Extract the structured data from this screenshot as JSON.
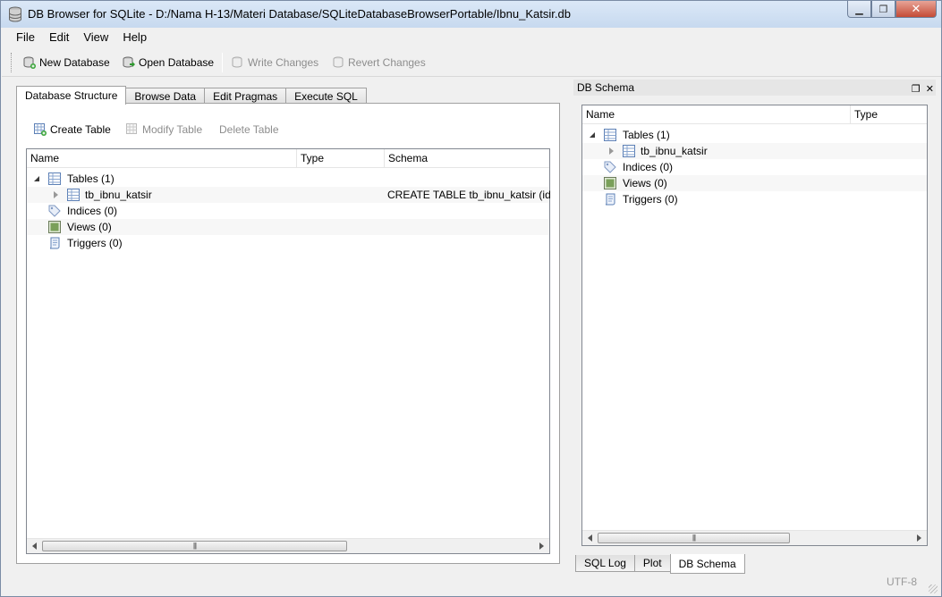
{
  "window": {
    "title": "DB Browser for SQLite - D:/Nama H-13/Materi Database/SQLiteDatabaseBrowserPortable/Ibnu_Katsir.db",
    "app_icon": "database-icon"
  },
  "menu": [
    "File",
    "Edit",
    "View",
    "Help"
  ],
  "toolbar": {
    "new_database": "New Database",
    "open_database": "Open Database",
    "write_changes": "Write Changes",
    "revert_changes": "Revert Changes"
  },
  "tabs": [
    "Database Structure",
    "Browse Data",
    "Edit Pragmas",
    "Execute SQL"
  ],
  "structure": {
    "create_table": "Create Table",
    "modify_table": "Modify Table",
    "delete_table": "Delete Table",
    "columns": [
      "Name",
      "Type",
      "Schema"
    ],
    "rows": [
      {
        "name": "Tables (1)",
        "type": "",
        "schema": "",
        "icon": "table-icon",
        "expanded": true
      },
      {
        "name": "tb_ibnu_katsir",
        "type": "",
        "schema": "CREATE TABLE tb_ibnu_katsir (id IN",
        "icon": "table-icon",
        "expanded": false
      },
      {
        "name": "Indices (0)",
        "type": "",
        "schema": "",
        "icon": "index-icon"
      },
      {
        "name": "Views (0)",
        "type": "",
        "schema": "",
        "icon": "view-icon"
      },
      {
        "name": "Triggers (0)",
        "type": "",
        "schema": "",
        "icon": "trigger-icon"
      }
    ],
    "scroll_thumb": "|||"
  },
  "dock": {
    "title": "DB Schema",
    "columns": [
      "Name",
      "Type"
    ],
    "rows": [
      {
        "name": "Tables (1)",
        "icon": "table-icon"
      },
      {
        "name": "tb_ibnu_katsir",
        "icon": "table-icon"
      },
      {
        "name": "Indices (0)",
        "icon": "index-icon"
      },
      {
        "name": "Views (0)",
        "icon": "view-icon"
      },
      {
        "name": "Triggers (0)",
        "icon": "trigger-icon"
      }
    ],
    "scroll_thumb": "|||"
  },
  "bottom_tabs": [
    "SQL Log",
    "Plot",
    "DB Schema"
  ],
  "status": {
    "encoding": "UTF-8"
  }
}
